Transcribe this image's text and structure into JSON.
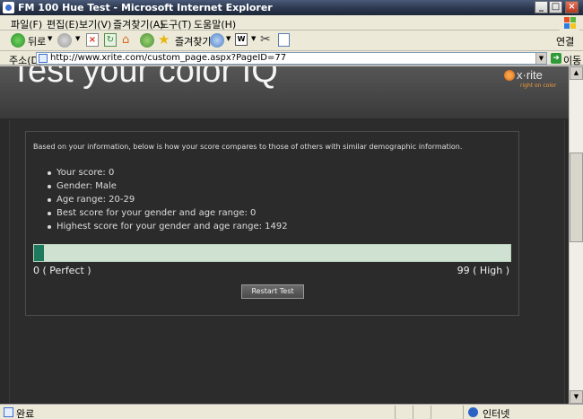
{
  "window": {
    "title": "FM 100 Hue Test - Microsoft Internet Explorer"
  },
  "menubar": {
    "items": [
      "파일(F)",
      "편집(E)",
      "보기(V)",
      "즐겨찾기(A)",
      "도구(T)",
      "도움말(H)"
    ]
  },
  "toolbar": {
    "back_label": "뒤로",
    "favorites_label": "즐겨찾기",
    "links_label": "연결"
  },
  "addressbar": {
    "label": "주소(D)",
    "url": "http://www.xrite.com/custom_page.aspx?PageID=77",
    "go_label": "이동"
  },
  "page": {
    "title": "Test your color IQ",
    "logo": {
      "brand": "x·rite",
      "tagline": "right on color"
    },
    "intro": "Based on your information, below is how your score compares to those of others with similar demographic information.",
    "stats": [
      "Your score: 0",
      "Gender: Male",
      "Age range: 20-29",
      "Best score for your gender and age range: 0",
      "Highest score for your gender and age range: 1492"
    ],
    "score_bar": {
      "position_fraction": 0.02,
      "fill_color": "#1e7a5c",
      "track_color": "#cfe2d1"
    },
    "scale_min_label": "0 ( Perfect )",
    "scale_max_label": "99 ( High )",
    "restart_label": "Restart Test"
  },
  "statusbar": {
    "status": "완료",
    "zone": "인터넷"
  },
  "icons": {
    "back": "back-arrow-icon",
    "forward": "forward-arrow-icon",
    "stop": "stop-icon",
    "refresh": "refresh-icon",
    "home": "home-icon",
    "search": "search-icon",
    "favorites": "favorites-star-icon",
    "media": "media-icon",
    "mail": "mail-icon",
    "edit": "edit-icon",
    "cut": "cut-icon",
    "copy": "copy-icon",
    "go": "go-arrow-icon"
  }
}
